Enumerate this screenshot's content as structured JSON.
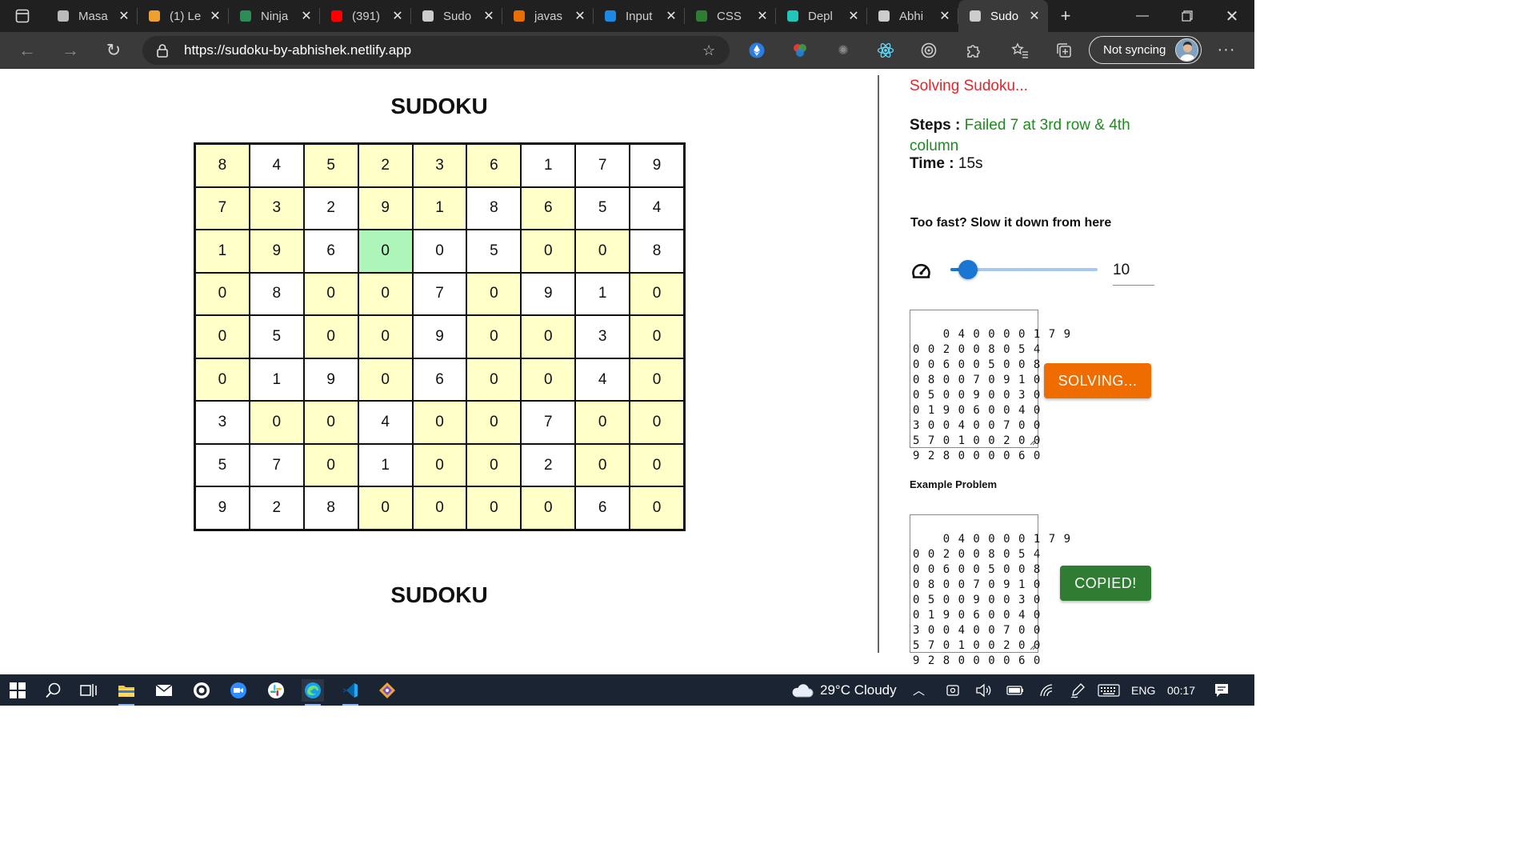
{
  "browser": {
    "tabs": [
      {
        "title": "Masa",
        "icon": "document-icon",
        "color": "#bbbbbb"
      },
      {
        "title": "(1) Le",
        "icon": "leetcode-icon",
        "color": "#f0a030"
      },
      {
        "title": "Ninja",
        "icon": "plus-square-icon",
        "color": "#2e8b57"
      },
      {
        "title": "(391)",
        "icon": "youtube-icon",
        "color": "#ff0000"
      },
      {
        "title": "Sudo",
        "icon": "ninja-icon",
        "color": "#cccccc"
      },
      {
        "title": "javas",
        "icon": "java-icon",
        "color": "#e76f00"
      },
      {
        "title": "Input",
        "icon": "mui-icon",
        "color": "#1e88e5"
      },
      {
        "title": "CSS",
        "icon": "w-logo-icon",
        "color": "#2e7d32"
      },
      {
        "title": "Depl",
        "icon": "netlify-icon",
        "color": "#20c6b7"
      },
      {
        "title": "Abhi",
        "icon": "ninja-icon",
        "color": "#cccccc"
      },
      {
        "title": "Sudo",
        "icon": "ninja-icon",
        "color": "#cccccc",
        "active": true
      }
    ],
    "url": "https://sudoku-by-abhishek.netlify.app",
    "profile_label": "Not syncing"
  },
  "page": {
    "title_top": "SUDOKU",
    "title_bottom": "SUDOKU",
    "grid": [
      [
        "8",
        "4",
        "5",
        "2",
        "3",
        "6",
        "1",
        "7",
        "9"
      ],
      [
        "7",
        "3",
        "2",
        "9",
        "1",
        "8",
        "6",
        "5",
        "4"
      ],
      [
        "1",
        "9",
        "6",
        "0",
        "0",
        "5",
        "0",
        "0",
        "8"
      ],
      [
        "0",
        "8",
        "0",
        "0",
        "7",
        "0",
        "9",
        "1",
        "0"
      ],
      [
        "0",
        "5",
        "0",
        "0",
        "9",
        "0",
        "0",
        "3",
        "0"
      ],
      [
        "0",
        "1",
        "9",
        "0",
        "6",
        "0",
        "0",
        "4",
        "0"
      ],
      [
        "3",
        "0",
        "0",
        "4",
        "0",
        "0",
        "7",
        "0",
        "0"
      ],
      [
        "5",
        "7",
        "0",
        "1",
        "0",
        "0",
        "2",
        "0",
        "0"
      ],
      [
        "9",
        "2",
        "8",
        "0",
        "0",
        "0",
        "0",
        "6",
        "0"
      ]
    ],
    "highlighted": [
      [
        1,
        0,
        1,
        1,
        1,
        1,
        0,
        0,
        0
      ],
      [
        1,
        1,
        0,
        1,
        1,
        0,
        1,
        0,
        0
      ],
      [
        1,
        1,
        0,
        2,
        0,
        0,
        1,
        1,
        0
      ],
      [
        1,
        0,
        1,
        1,
        0,
        1,
        0,
        0,
        1
      ],
      [
        1,
        0,
        1,
        1,
        0,
        1,
        1,
        0,
        1
      ],
      [
        1,
        0,
        0,
        1,
        0,
        1,
        1,
        0,
        1
      ],
      [
        0,
        1,
        1,
        0,
        1,
        1,
        0,
        1,
        1
      ],
      [
        0,
        0,
        1,
        0,
        1,
        1,
        0,
        1,
        1
      ],
      [
        0,
        0,
        0,
        1,
        1,
        1,
        1,
        0,
        1
      ]
    ],
    "status": "Solving Sudoku...",
    "steps_label": "Steps :",
    "steps_value": "Failed 7 at 3rd row & 4th column",
    "time_label": "Time :",
    "time_value": "15s",
    "speed_label": "Too fast? Slow it down from here",
    "speed_value": "10",
    "speed_fraction": 0.09,
    "puzzle_input": "0 4 0 0 0 0 1 7 9\n0 0 2 0 0 8 0 5 4\n0 0 6 0 0 5 0 0 8\n0 8 0 0 7 0 9 1 0\n0 5 0 0 9 0 0 3 0\n0 1 9 0 6 0 0 4 0\n3 0 0 4 0 0 7 0 0\n5 7 0 1 0 0 2 0 0\n9 2 8 0 0 0 0 6 0",
    "solving_button": "SOLVING...",
    "example_label": "Example Problem",
    "example_input": "0 4 0 0 0 0 1 7 9\n0 0 2 0 0 8 0 5 4\n0 0 6 0 0 5 0 0 8\n0 8 0 0 7 0 9 1 0\n0 5 0 0 9 0 0 3 0\n0 1 9 0 6 0 0 4 0\n3 0 0 4 0 0 7 0 0\n5 7 0 1 0 0 2 0 0\n9 2 8 0 0 0 0 6 0",
    "copied_button": "COPIED!"
  },
  "taskbar": {
    "weather": "29°C  Cloudy",
    "language": "ENG",
    "clock": "00:17"
  },
  "colors": {
    "filled_cell": "#ffffc8",
    "current_cell": "#adf5b8",
    "solving_button": "#ef6c00",
    "copied_button": "#2e7d32",
    "status_text": "#e8232a",
    "steps_text": "#1f8a1f",
    "slider": "#1976d2"
  }
}
